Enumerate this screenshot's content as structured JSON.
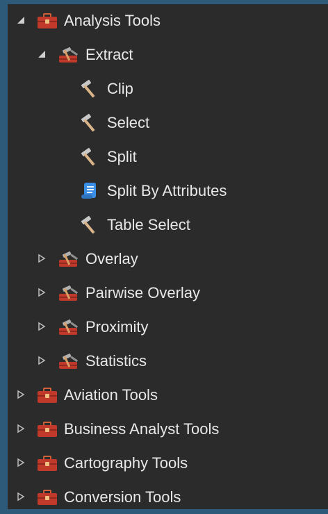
{
  "tree": {
    "analysis_tools": {
      "label": "Analysis Tools",
      "caret": "expanded-caret-icon",
      "icon": "toolbox-icon",
      "children": {
        "extract": {
          "label": "Extract",
          "caret": "expanded-caret-icon",
          "icon": "toolset-icon",
          "tools": [
            {
              "label": "Clip",
              "icon": "hammer-icon"
            },
            {
              "label": "Select",
              "icon": "hammer-icon"
            },
            {
              "label": "Split",
              "icon": "hammer-icon"
            },
            {
              "label": "Split By Attributes",
              "icon": "script-icon"
            },
            {
              "label": "Table Select",
              "icon": "hammer-icon"
            }
          ]
        },
        "toolsets": [
          {
            "label": "Overlay",
            "caret": "collapsed-caret-icon",
            "icon": "toolset-icon"
          },
          {
            "label": "Pairwise Overlay",
            "caret": "collapsed-caret-icon",
            "icon": "toolset-icon"
          },
          {
            "label": "Proximity",
            "caret": "collapsed-caret-icon",
            "icon": "toolset-icon"
          },
          {
            "label": "Statistics",
            "caret": "collapsed-caret-icon",
            "icon": "toolset-icon"
          }
        ]
      }
    },
    "toolboxes": [
      {
        "label": "Aviation Tools",
        "caret": "collapsed-caret-icon",
        "icon": "toolbox-icon"
      },
      {
        "label": "Business Analyst Tools",
        "caret": "collapsed-caret-icon",
        "icon": "toolbox-icon"
      },
      {
        "label": "Cartography Tools",
        "caret": "collapsed-caret-icon",
        "icon": "toolbox-icon"
      },
      {
        "label": "Conversion Tools",
        "caret": "collapsed-caret-icon",
        "icon": "toolbox-icon"
      }
    ]
  },
  "colors": {
    "background_outer": "#2e5a7a",
    "panel": "#2b2b2b",
    "text": "#e8e8e8",
    "toolbox_red": "#c0392b",
    "script_blue": "#3a8ee6"
  }
}
